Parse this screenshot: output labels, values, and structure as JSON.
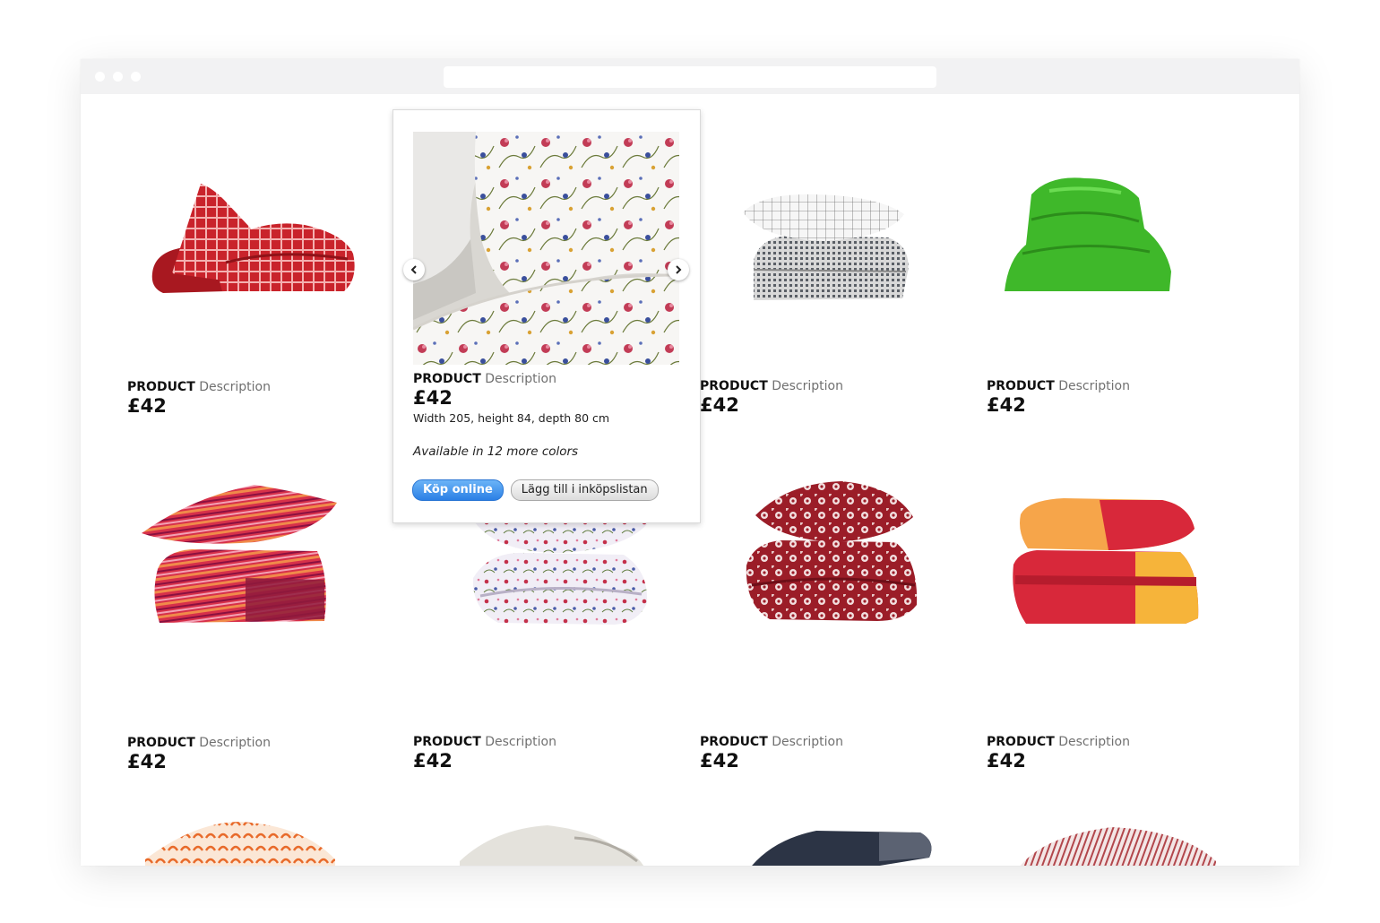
{
  "browser": {
    "address_bar": ""
  },
  "products": [
    {
      "name": "PRODUCT",
      "desc": "Description",
      "price": "£42"
    },
    {
      "name": "PRODUCT",
      "desc": "Description",
      "price": "£42"
    },
    {
      "name": "PRODUCT",
      "desc": "Description",
      "price": "£42"
    },
    {
      "name": "PRODUCT",
      "desc": "Description",
      "price": "£42"
    },
    {
      "name": "PRODUCT",
      "desc": "Description",
      "price": "£42"
    },
    {
      "name": "PRODUCT",
      "desc": "Description",
      "price": "£42"
    },
    {
      "name": "PRODUCT",
      "desc": "Description",
      "price": "£42"
    },
    {
      "name": "PRODUCT",
      "desc": "Description",
      "price": "£42"
    }
  ],
  "popup": {
    "name": "PRODUCT",
    "desc": "Description",
    "price": "£42",
    "dimensions": "Width 205, height 84, depth 80 cm",
    "availability": "Available in 12 more colors",
    "buy_label": "Köp online",
    "list_label": "Lägg till i inköpslistan"
  },
  "colors": {
    "primary_button": "#2b7fe5",
    "description_text": "#707070"
  }
}
